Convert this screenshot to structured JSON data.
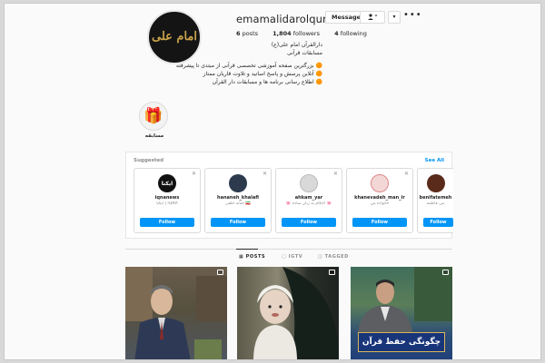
{
  "profile": {
    "username": "emamalidarolquran",
    "logo_text": "امام علی",
    "buttons": {
      "message": "Message",
      "follow_icon": "follow-person-icon",
      "chevron": "chevron-down-icon",
      "more": "more-options-icon"
    },
    "stats": {
      "posts": "6",
      "posts_label": "posts",
      "followers": "1,804",
      "followers_label": "followers",
      "following": "4",
      "following_label": "following"
    },
    "bio": [
      "دارالقرآن امام علی(ع)",
      "مسابقات قرآنی",
      "",
      "بزرگترین صفحه آموزشی تخصصی قرآنی از مبتدی تا پیشرفته",
      "آنلاین پرسش و پاسخ اساتید و تلاوت قاریان ممتاز",
      "اطلاع رسانی برنامه ها و مسابقات دار القرآن"
    ]
  },
  "highlight": {
    "label": "مسابقه",
    "icon": "gift-icon"
  },
  "suggested": {
    "title": "Suggested",
    "see_all": "See All",
    "cards": [
      {
        "name": "iqnanews",
        "sub": "ایکنا | IQNA",
        "button": "Follow",
        "avatar_color": "#ffffff",
        "avatar_text": "ایکنا"
      },
      {
        "name": "hananeh_khalafi",
        "sub": "حنانه خلفی 🇮🇷",
        "button": "Follow",
        "avatar_color": "#2d3a4e",
        "avatar_text": ""
      },
      {
        "name": "ahkam_yar",
        "sub": "🌸 احکام به زبان ساده 🌸",
        "button": "Follow",
        "avatar_color": "#d9d9d9",
        "avatar_text": ""
      },
      {
        "name": "khanevadeh_man_ir",
        "sub": "خانواده من",
        "button": "Follow",
        "avatar_color": "#f3d7d7",
        "avatar_text": ""
      },
      {
        "name": "benifatemeh",
        "sub": "بنی فاطمه",
        "button": "Follow",
        "avatar_color": "#5a2a1a",
        "avatar_text": ""
      }
    ]
  },
  "tabs": [
    {
      "label": "POSTS",
      "icon": "grid-icon",
      "active": true
    },
    {
      "label": "IGTV",
      "icon": "igtv-icon",
      "active": false
    },
    {
      "label": "TAGGED",
      "icon": "tag-icon",
      "active": false
    }
  ],
  "posts": [
    {
      "caption": ""
    },
    {
      "caption": ""
    },
    {
      "caption": "چگونگی حفظ قرآن"
    }
  ]
}
